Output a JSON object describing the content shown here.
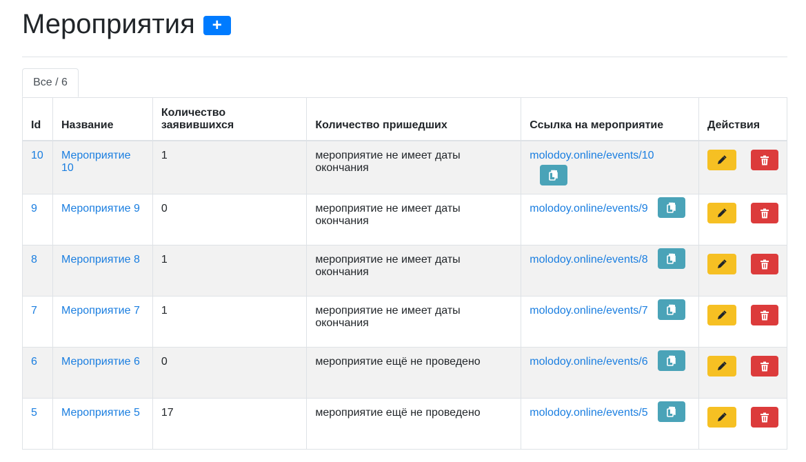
{
  "page": {
    "title": "Мероприятия",
    "add_label": "+"
  },
  "tabs": [
    {
      "label": "Все / 6"
    }
  ],
  "table": {
    "headers": {
      "id": "Id",
      "name": "Название",
      "registered": "Количество заявившихся",
      "attended": "Количество пришедших",
      "link": "Ссылка на мероприятие",
      "actions": "Действия"
    },
    "rows": [
      {
        "id": "10",
        "name": "Мероприятие 10",
        "registered": "1",
        "attended": "мероприятие не имеет даты окончания",
        "link": "molodoy.online/events/10"
      },
      {
        "id": "9",
        "name": "Мероприятие 9",
        "registered": "0",
        "attended": "мероприятие не имеет даты окончания",
        "link": "molodoy.online/events/9"
      },
      {
        "id": "8",
        "name": "Мероприятие 8",
        "registered": "1",
        "attended": "мероприятие не имеет даты окончания",
        "link": "molodoy.online/events/8"
      },
      {
        "id": "7",
        "name": "Мероприятие 7",
        "registered": "1",
        "attended": "мероприятие не имеет даты окончания",
        "link": "molodoy.online/events/7"
      },
      {
        "id": "6",
        "name": "Мероприятие 6",
        "registered": "0",
        "attended": "мероприятие ещё не проведено",
        "link": "molodoy.online/events/6"
      },
      {
        "id": "5",
        "name": "Мероприятие 5",
        "registered": "17",
        "attended": "мероприятие ещё не проведено",
        "link": "molodoy.online/events/5"
      }
    ]
  },
  "icons": {
    "add": "plus-icon",
    "copy": "copy-icon",
    "edit": "pencil-icon",
    "delete": "trash-icon"
  },
  "colors": {
    "primary": "#007bff",
    "info": "#4aa3b8",
    "warning": "#f6c023",
    "danger": "#dc3b3b",
    "link": "#1a7ee0"
  }
}
